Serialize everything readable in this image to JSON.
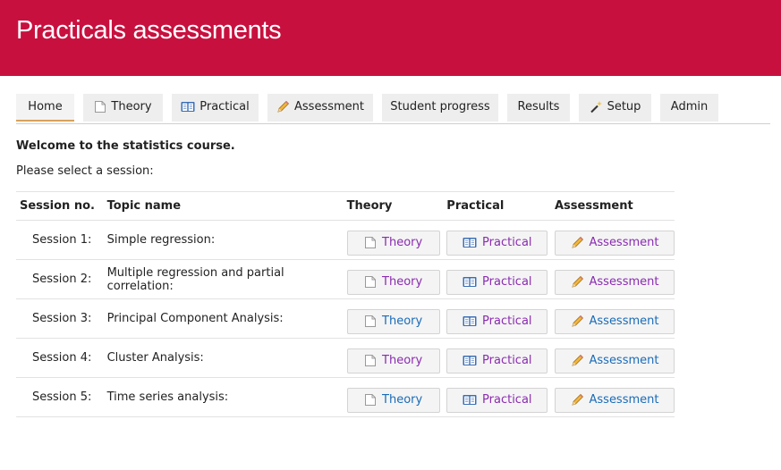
{
  "header": {
    "title": "Practicals assessments"
  },
  "nav": {
    "tabs": [
      {
        "label": "Home",
        "icon": ""
      },
      {
        "label": "Theory",
        "icon": "page-icon"
      },
      {
        "label": "Practical",
        "icon": "book-icon"
      },
      {
        "label": "Assessment",
        "icon": "pencil-icon"
      },
      {
        "label": "Student progress",
        "icon": ""
      },
      {
        "label": "Results",
        "icon": ""
      },
      {
        "label": "Setup",
        "icon": "wand-icon"
      },
      {
        "label": "Admin",
        "icon": ""
      }
    ],
    "active": "Home"
  },
  "main": {
    "welcome": "Welcome to the statistics course.",
    "prompt": "Please select a session:",
    "columns": [
      "Session no.",
      "Topic name",
      "Theory",
      "Practical",
      "Assessment"
    ],
    "sessions": [
      {
        "no": "Session 1:",
        "topic": "Simple regression:",
        "theory": "Theory",
        "practical": "Practical",
        "assessment": "Assessment"
      },
      {
        "no": "Session 2:",
        "topic": "Multiple regression and partial correlation:",
        "theory": "Theory",
        "practical": "Practical",
        "assessment": "Assessment"
      },
      {
        "no": "Session 3:",
        "topic": "Principal Component Analysis:",
        "theory": "Theory",
        "practical": "Practical",
        "assessment": "Assessment"
      },
      {
        "no": "Session 4:",
        "topic": "Cluster Analysis:",
        "theory": "Theory",
        "practical": "Practical",
        "assessment": "Assessment"
      },
      {
        "no": "Session 5:",
        "topic": "Time series analysis:",
        "theory": "Theory",
        "practical": "Practical",
        "assessment": "Assessment"
      }
    ]
  },
  "colors": {
    "header_bg": "#c8103f",
    "active_tab_underline": "#d7a25c",
    "link_visited": "#8a2bb0",
    "link_unvisited": "#1a6bb8"
  }
}
